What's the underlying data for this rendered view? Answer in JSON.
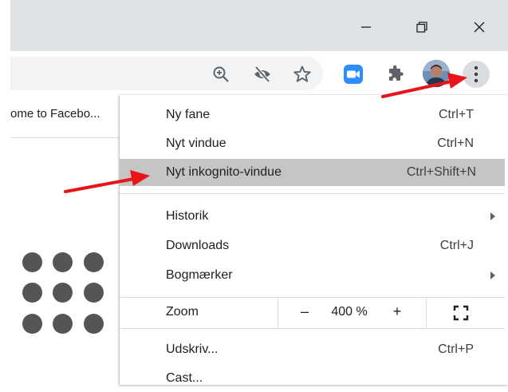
{
  "tab": {
    "title": "ome to Facebo..."
  },
  "menu": {
    "items": [
      {
        "label": "Ny fane",
        "shortcut": "Ctrl+T"
      },
      {
        "label": "Nyt vindue",
        "shortcut": "Ctrl+N"
      },
      {
        "label": "Nyt inkognito-vindue",
        "shortcut": "Ctrl+Shift+N"
      },
      {
        "label": "Historik",
        "shortcut": ""
      },
      {
        "label": "Downloads",
        "shortcut": "Ctrl+J"
      },
      {
        "label": "Bogmærker",
        "shortcut": ""
      },
      {
        "label": "Udskriv...",
        "shortcut": "Ctrl+P"
      },
      {
        "label": "Cast...",
        "shortcut": ""
      }
    ],
    "zoom": {
      "label": "Zoom",
      "minus": "–",
      "value": "400 %",
      "plus": "+"
    }
  },
  "colors": {
    "titlebar": "#dee1e6",
    "highlight": "#c5c5c5",
    "arrow": "#e8141a",
    "zoom_app": "#2d8cff",
    "dots": "#555558"
  },
  "icons": {
    "minimize": "minimize-icon",
    "restore": "restore-icon",
    "close": "close-icon",
    "zoom_in": "zoom-in-icon",
    "eye_off": "eye-off-icon",
    "star": "star-icon",
    "zoom_ext": "zoom-video-icon",
    "puzzle": "extensions-icon",
    "menu": "kebab-menu-icon"
  }
}
